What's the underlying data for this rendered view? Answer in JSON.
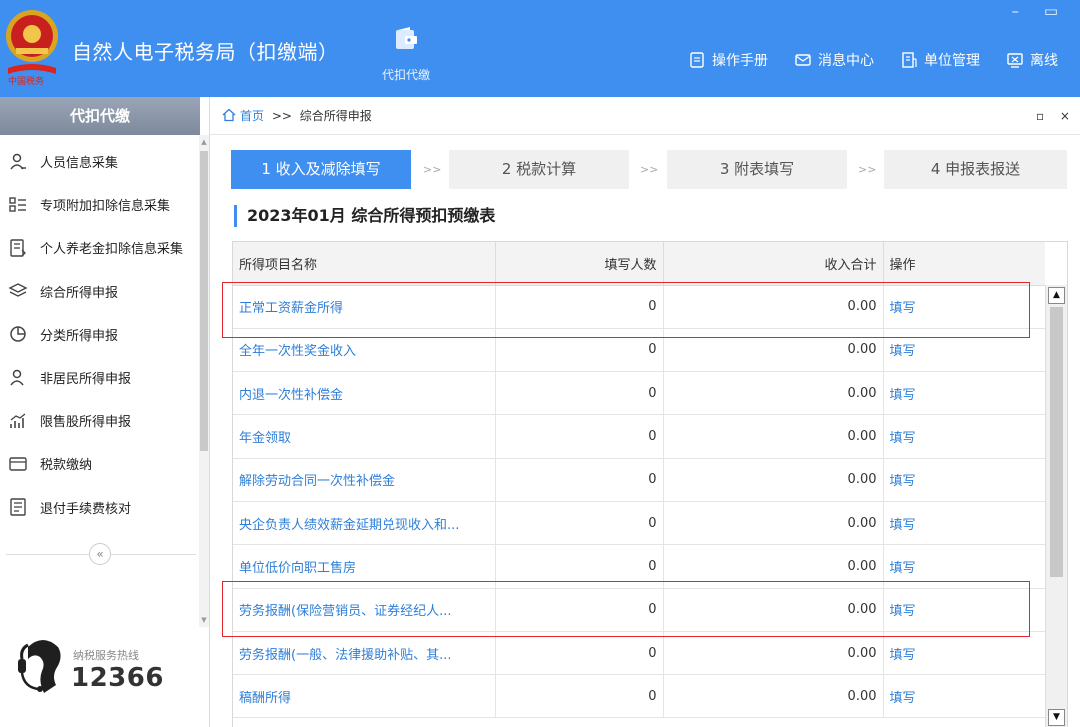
{
  "header": {
    "app_title": "自然人电子税务局（扣缴端）",
    "module_label": "代扣代缴",
    "window_controls": "– ▭",
    "links": [
      {
        "label": "操作手册",
        "icon": "manual-icon"
      },
      {
        "label": "消息中心",
        "icon": "mail-icon"
      },
      {
        "label": "单位管理",
        "icon": "building-icon"
      },
      {
        "label": "离线",
        "icon": "offline-icon"
      }
    ]
  },
  "sidebar": {
    "title": "代扣代缴",
    "items": [
      {
        "label": "人员信息采集",
        "icon": "person-icon"
      },
      {
        "label": "专项附加扣除信息采集",
        "icon": "list-icon"
      },
      {
        "label": "个人养老金扣除信息采集",
        "icon": "document-icon"
      },
      {
        "label": "综合所得申报",
        "icon": "layers-icon"
      },
      {
        "label": "分类所得申报",
        "icon": "pie-icon"
      },
      {
        "label": "非居民所得申报",
        "icon": "user-icon"
      },
      {
        "label": "限售股所得申报",
        "icon": "chart-icon"
      },
      {
        "label": "税款缴纳",
        "icon": "wallet-icon"
      },
      {
        "label": "退付手续费核对",
        "icon": "check-doc-icon"
      }
    ],
    "collapse_label": "«",
    "hotline_label": "纳税服务热线",
    "hotline_number": "12366"
  },
  "breadcrumb": {
    "home": "首页",
    "separator": ">>",
    "current": "综合所得申报",
    "controls": "▫ ×"
  },
  "steps": [
    {
      "label": "1 收入及减除填写",
      "active": true
    },
    {
      "label": "2 税款计算",
      "active": false
    },
    {
      "label": "3 附表填写",
      "active": false
    },
    {
      "label": "4 申报表报送",
      "active": false
    }
  ],
  "step_separator": ">>",
  "section_title": "2023年01月  综合所得预扣预缴表",
  "table": {
    "columns": [
      "所得项目名称",
      "填写人数",
      "收入合计",
      "操作"
    ],
    "rows": [
      {
        "name": "正常工资薪金所得",
        "count": "0",
        "total": "0.00",
        "action": "填写"
      },
      {
        "name": "全年一次性奖金收入",
        "count": "0",
        "total": "0.00",
        "action": "填写"
      },
      {
        "name": "内退一次性补偿金",
        "count": "0",
        "total": "0.00",
        "action": "填写"
      },
      {
        "name": "年金领取",
        "count": "0",
        "total": "0.00",
        "action": "填写"
      },
      {
        "name": "解除劳动合同一次性补偿金",
        "count": "0",
        "total": "0.00",
        "action": "填写"
      },
      {
        "name": "央企负责人绩效薪金延期兑现收入和...",
        "count": "0",
        "total": "0.00",
        "action": "填写"
      },
      {
        "name": "单位低价向职工售房",
        "count": "0",
        "total": "0.00",
        "action": "填写"
      },
      {
        "name": "劳务报酬(保险营销员、证券经纪人...",
        "count": "0",
        "total": "0.00",
        "action": "填写"
      },
      {
        "name": "劳务报酬(一般、法律援助补贴、其...",
        "count": "0",
        "total": "0.00",
        "action": "填写"
      },
      {
        "name": "稿酬所得",
        "count": "0",
        "total": "0.00",
        "action": "填写"
      }
    ]
  },
  "colors": {
    "header_bg": "#3f8ff0",
    "link_blue": "#2f7fd8",
    "highlight_red": "#e2262b"
  }
}
